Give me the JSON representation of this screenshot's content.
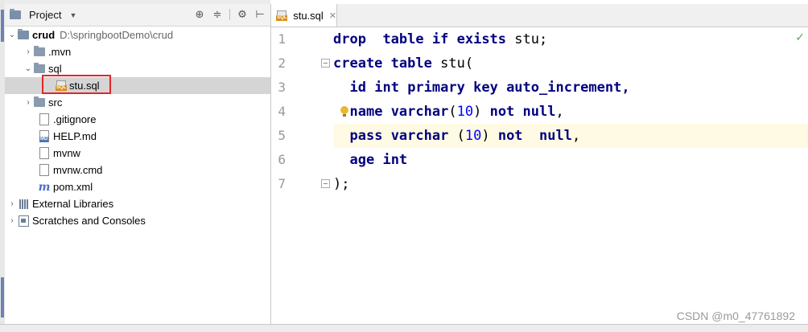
{
  "project_panel": {
    "title": "Project",
    "tree": [
      {
        "label": "crud",
        "detail": "D:\\springbootDemo\\crud"
      },
      {
        "label": ".mvn"
      },
      {
        "label": "sql"
      },
      {
        "label": "stu.sql"
      },
      {
        "label": "src"
      },
      {
        "label": ".gitignore"
      },
      {
        "label": "HELP.md"
      },
      {
        "label": "mvnw"
      },
      {
        "label": "mvnw.cmd"
      },
      {
        "label": "pom.xml"
      },
      {
        "label": "External Libraries"
      },
      {
        "label": "Scratches and Consoles"
      }
    ]
  },
  "editor": {
    "tab_label": "stu.sql",
    "line_numbers": [
      "1",
      "2",
      "3",
      "4",
      "5",
      "6",
      "7"
    ],
    "code": {
      "l1": {
        "k1": "drop",
        "k2": "table",
        "k3": "if",
        "k4": "exists",
        "t1": "stu;"
      },
      "l2": {
        "k1": "create",
        "k2": "table",
        "t1": "stu("
      },
      "l3": {
        "t1": "id",
        "k1": "int",
        "k2": "primary",
        "k3": "key",
        "t2": "auto_increment,"
      },
      "l4": {
        "t1": "name",
        "k1": "varchar",
        "t2": "(",
        "n1": "10",
        "t3": ")",
        "k2": "not",
        "k3": "null",
        "t4": ","
      },
      "l5": {
        "t1": "pass",
        "k1": "varchar",
        "t2": "(",
        "n1": "10",
        "t3": ")",
        "k2": "not",
        "k3": "null",
        "t4": ","
      },
      "l6": {
        "t1": "age",
        "k1": "int"
      },
      "l7": {
        "t1": ");"
      }
    }
  },
  "watermark": "CSDN @m0_47761892"
}
